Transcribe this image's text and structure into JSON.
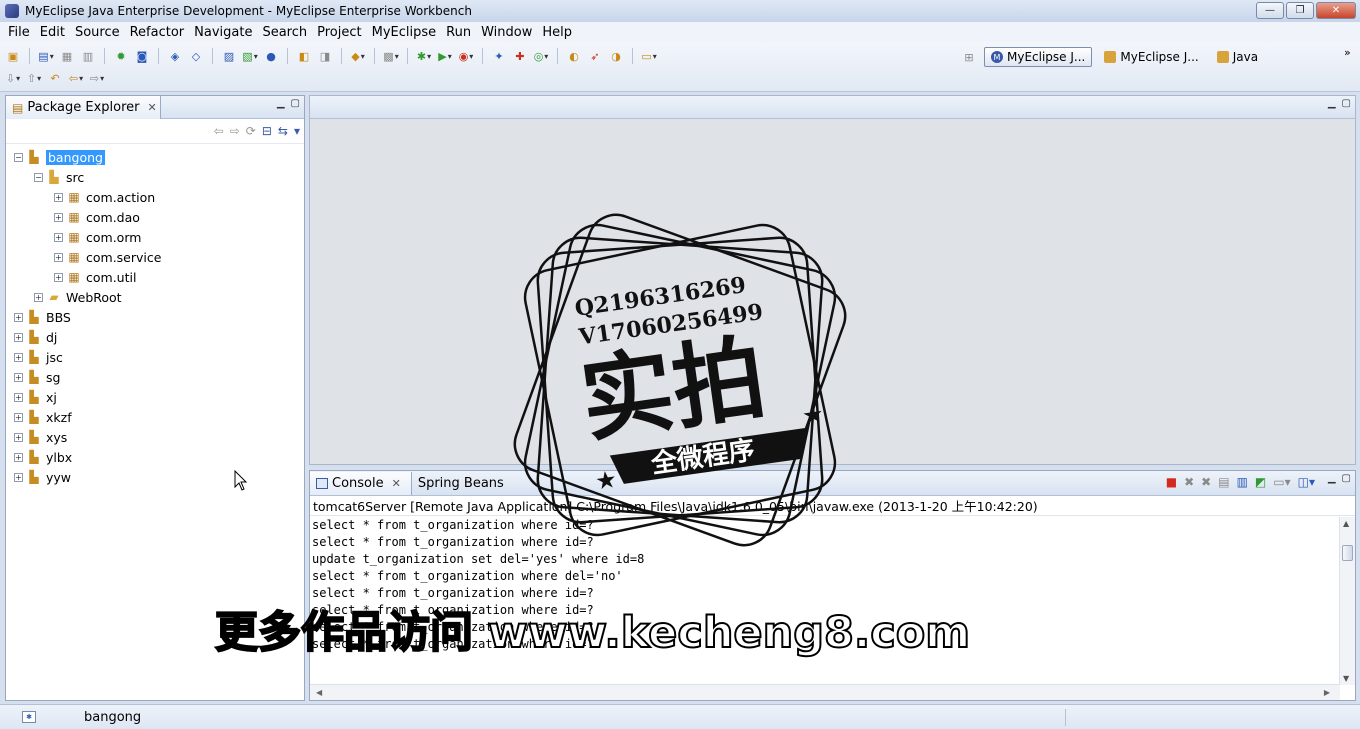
{
  "window": {
    "title": "MyEclipse Java Enterprise Development - MyEclipse Enterprise Workbench",
    "minimize_label": "—",
    "maximize_label": "❐",
    "close_label": "✕"
  },
  "menu": [
    "File",
    "Edit",
    "Source",
    "Refactor",
    "Navigate",
    "Search",
    "Project",
    "MyEclipse",
    "Run",
    "Window",
    "Help"
  ],
  "perspectives": [
    {
      "label": "MyEclipse J...",
      "active": true
    },
    {
      "label": "MyEclipse J...",
      "active": false
    },
    {
      "label": "Java",
      "active": false
    }
  ],
  "package_explorer": {
    "tab_label": "Package Explorer",
    "tree": [
      {
        "label": "bangong",
        "expanded": true,
        "selected": true,
        "icon": "project-icon"
      },
      {
        "label": "src",
        "expanded": true,
        "icon": "source-folder-icon"
      },
      {
        "label": "com.action",
        "icon": "package-icon"
      },
      {
        "label": "com.dao",
        "icon": "package-icon"
      },
      {
        "label": "com.orm",
        "icon": "package-icon"
      },
      {
        "label": "com.service",
        "icon": "package-icon"
      },
      {
        "label": "com.util",
        "icon": "package-icon"
      },
      {
        "label": "WebRoot",
        "icon": "folder-icon"
      },
      {
        "label": "BBS",
        "icon": "project-icon"
      },
      {
        "label": "dj",
        "icon": "project-icon"
      },
      {
        "label": "jsc",
        "icon": "project-icon"
      },
      {
        "label": "sg",
        "icon": "project-icon"
      },
      {
        "label": "xj",
        "icon": "project-icon"
      },
      {
        "label": "xkzf",
        "icon": "project-icon"
      },
      {
        "label": "xys",
        "icon": "project-icon"
      },
      {
        "label": "ylbx",
        "icon": "project-icon"
      },
      {
        "label": "yyw",
        "icon": "project-icon"
      }
    ]
  },
  "console": {
    "tabs": [
      "Console",
      "Spring Beans"
    ],
    "process": "tomcat6Server [Remote Java Application] C:\\Program Files\\Java\\jdk1.6.0_05\\bin\\javaw.exe (2013-1-20 上午10:42:20)",
    "lines": [
      "select * from t_organization where id=?",
      "select * from t_organization where id=?",
      "update t_organization set del='yes' where id=8",
      "select * from t_organization where del='no'",
      "select * from t_organization where id=?",
      "select * from t_organization where id=?",
      "select * from t_organization where id=?",
      "select * from t_organization where id=?"
    ]
  },
  "status": {
    "selected": "bangong"
  },
  "overlays": {
    "stamp_line1": "Q2196316269",
    "stamp_line2": "V17060256499",
    "stamp_big": "实拍",
    "stamp_banner": "全微程序",
    "watermark": "更多作品访问 www.kecheng8.com"
  },
  "colors": {
    "selection": "#3399ff",
    "terminate_red": "#d22a1e"
  }
}
